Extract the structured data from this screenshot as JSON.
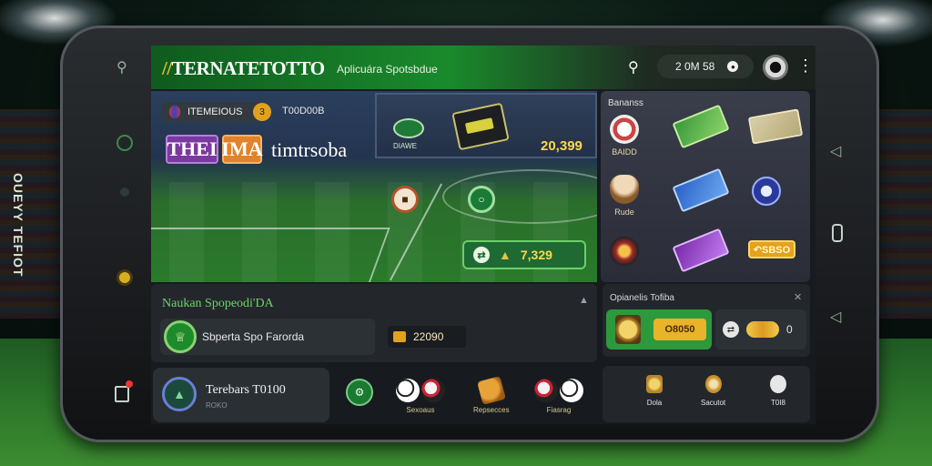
{
  "app": {
    "logo_mark": "//",
    "logo_text": "TERNATETOTTO",
    "subtitle": "Aplicuára Spotsbdue"
  },
  "topbar": {
    "balance": "2 0M 58",
    "kebab": "⋮"
  },
  "hero": {
    "chip_label": "ITEMEIOUS",
    "chip_badge": "3",
    "label": "T00D00B",
    "badge_a": "THEI",
    "badge_b": "IMA",
    "title": "timtrsoba",
    "billboard_token_label": "DIAWE",
    "billboard_value": "20,399",
    "odds_value": "7,329"
  },
  "shop": {
    "title": "Bananss",
    "items": [
      {
        "label": "BAIDD"
      },
      {
        "label": "Rude"
      }
    ],
    "price": "↶SBSO"
  },
  "sponsor": {
    "title": "Naukan Spopeodi'DA",
    "row_label": "Sbperta Spo Farorda",
    "coin_value": "22090"
  },
  "tipster": {
    "title": "Opianelis Tofiba",
    "value": "O8050",
    "side_value": "0"
  },
  "bottom": {
    "profile_title": "Terebars T0100",
    "profile_sub": "ROKO",
    "sports": [
      {
        "label": "Sexoaus"
      },
      {
        "label": "Repsecces"
      },
      {
        "label": "Fiasrag"
      }
    ],
    "right_items": [
      {
        "label": "Dola"
      },
      {
        "label": "Sacutot"
      },
      {
        "label": "T0I8"
      }
    ]
  },
  "phone": {
    "vertical_text": "OUEYY TEFIOT"
  },
  "colors": {
    "brand_green": "#1a8a2c",
    "accent_gold": "#e9b32a",
    "panel_dark": "#23272b"
  }
}
